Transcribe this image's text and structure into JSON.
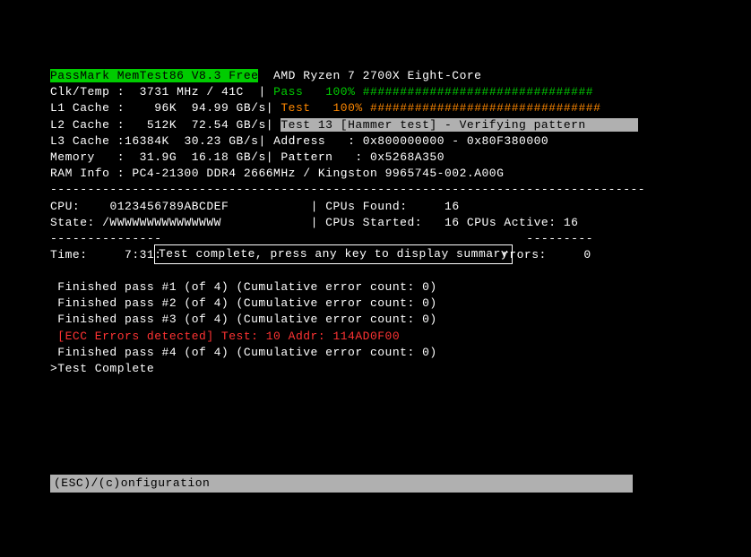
{
  "header": {
    "title_bg": "PassMark MemTest86 V8.3 Free",
    "cpu_name": "AMD Ryzen 7 2700X Eight-Core"
  },
  "stats": {
    "clk_temp_label": "Clk/Temp :",
    "clk_temp_value": "3731 MHz / 41C",
    "pass_label": "Pass",
    "pass_pct": "100%",
    "pass_bar": "###############################",
    "l1_label": "L1 Cache :",
    "l1_size": "96K",
    "l1_bw": "94.99 GB/s",
    "test_label": "Test",
    "test_pct": "100%",
    "test_bar": "###############################",
    "l2_label": "L2 Cache :",
    "l2_size": "512K",
    "l2_bw": "72.54 GB/s",
    "current_test": "Test 13 [Hammer test] - Verifying pattern       ",
    "l3_label": "L3 Cache :",
    "l3_size": "16384K",
    "l3_bw": "30.23 GB/s",
    "addr_label": "Address",
    "addr_value": "0x800000000 - 0x80F380000",
    "mem_label": "Memory   :",
    "mem_size": "31.9G",
    "mem_bw": "16.18 GB/s",
    "pattern_label": "Pattern",
    "pattern_value": "0x5268A350",
    "raminfo_label": "RAM Info :",
    "raminfo_value": "PC4-21300 DDR4 2666MHz / Kingston 9965745-002.A00G"
  },
  "cpu": {
    "cpu_label": "CPU:",
    "cpu_cores": "0123456789ABCDEF",
    "found_label": "CPUs Found:",
    "found_value": "16",
    "state_label": "State:",
    "state_value": "/WWWWWWWWWWWWWWW",
    "started_label": "CPUs Started:",
    "started_value": "16",
    "active_label": "CPUs Active:",
    "active_value": "16"
  },
  "status": {
    "time_label": "Time:",
    "time_value": "7:31:",
    "complete_msg": "Test complete, press any key to display summary",
    "errors_label": "rrors:",
    "errors_value": "0"
  },
  "log": {
    "pass1": " Finished pass #1 (of 4) (Cumulative error count: 0)",
    "pass2": " Finished pass #2 (of 4) (Cumulative error count: 0)",
    "pass3": " Finished pass #3 (of 4) (Cumulative error count: 0)",
    "ecc_error": " [ECC Errors detected] Test: 10 Addr: 114AD0F00",
    "pass4": " Finished pass #4 (of 4) (Cumulative error count: 0)",
    "complete": ">Test Complete"
  },
  "footer": {
    "text": "(ESC)/(c)onfiguration"
  },
  "dividers": {
    "dashes": "--------------------------------------------------------------------------------",
    "partial_left": "---------------",
    "partial_right": "---------"
  }
}
